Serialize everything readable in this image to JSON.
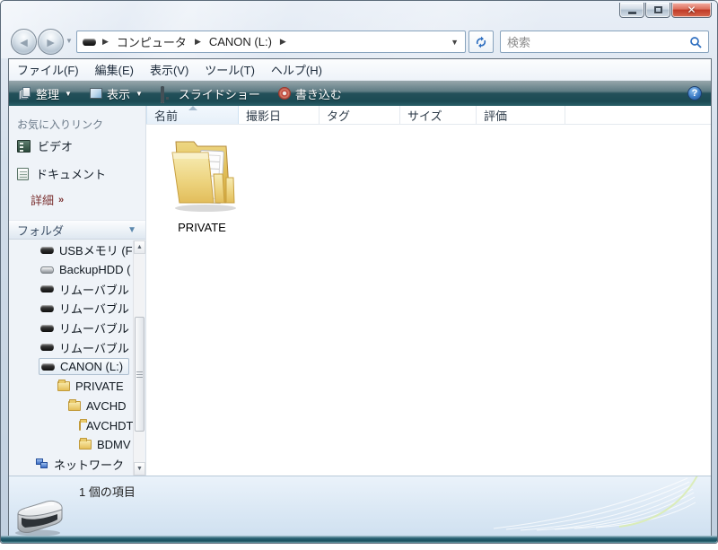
{
  "window": {
    "caption_buttons": {
      "minimize": "minimize",
      "maximize": "maximize",
      "close": "close"
    }
  },
  "navbar": {
    "breadcrumb": {
      "items": [
        {
          "label": "コンピュータ"
        },
        {
          "label": "CANON (L:)"
        }
      ]
    },
    "search": {
      "placeholder": "検索"
    }
  },
  "menubar": {
    "items": [
      "ファイル(F)",
      "編集(E)",
      "表示(V)",
      "ツール(T)",
      "ヘルプ(H)"
    ]
  },
  "toolbar": {
    "buttons": [
      {
        "label": "整理",
        "icon": "organize-icon",
        "has_dropdown": true
      },
      {
        "label": "表示",
        "icon": "views-icon",
        "has_dropdown": true
      },
      {
        "label": "スライドショー",
        "icon": "slideshow-icon",
        "has_dropdown": false
      },
      {
        "label": "書き込む",
        "icon": "burn-icon",
        "has_dropdown": false
      }
    ],
    "help_label": "?"
  },
  "sidebar": {
    "favorites_header": "お気に入りリンク",
    "favorites": [
      {
        "label": "ビデオ",
        "icon": "video-icon"
      },
      {
        "label": "ドキュメント",
        "icon": "document-icon"
      }
    ],
    "details_link": "詳細",
    "details_chevrons": "»",
    "folders_header": "フォルダ",
    "tree": [
      {
        "label": "USBメモリ (F",
        "icon": "drive-icon",
        "selected": false
      },
      {
        "label": "BackupHDD (",
        "icon": "drive-light-icon",
        "selected": false
      },
      {
        "label": "リムーバブル",
        "icon": "drive-icon",
        "selected": false
      },
      {
        "label": "リムーバブル",
        "icon": "drive-icon",
        "selected": false
      },
      {
        "label": "リムーバブル",
        "icon": "drive-icon",
        "selected": false
      },
      {
        "label": "リムーバブル",
        "icon": "drive-icon",
        "selected": false
      },
      {
        "label": "CANON (L:)",
        "icon": "drive-icon",
        "selected": true
      },
      {
        "label": "PRIVATE",
        "icon": "folder-icon",
        "selected": false
      },
      {
        "label": "AVCHD",
        "icon": "folder-icon",
        "selected": false
      },
      {
        "label": "AVCHDT",
        "icon": "folder-icon",
        "selected": false
      },
      {
        "label": "BDMV",
        "icon": "folder-icon",
        "selected": false
      },
      {
        "label": "ネットワーク",
        "icon": "network-icon",
        "selected": false
      }
    ]
  },
  "main": {
    "columns": [
      "名前",
      "撮影日",
      "タグ",
      "サイズ",
      "評価"
    ],
    "sorted_column": "名前",
    "items": [
      {
        "name": "PRIVATE",
        "type": "folder"
      }
    ]
  },
  "statusbar": {
    "text": "1 個の項目"
  },
  "colors": {
    "toolbar_teal": "#1b4a53",
    "close_button_red": "#c03a26",
    "selection_bg": "#e4edf5",
    "status_bg": "#d9e7f4",
    "folder_yellow": "#e5bf58"
  }
}
